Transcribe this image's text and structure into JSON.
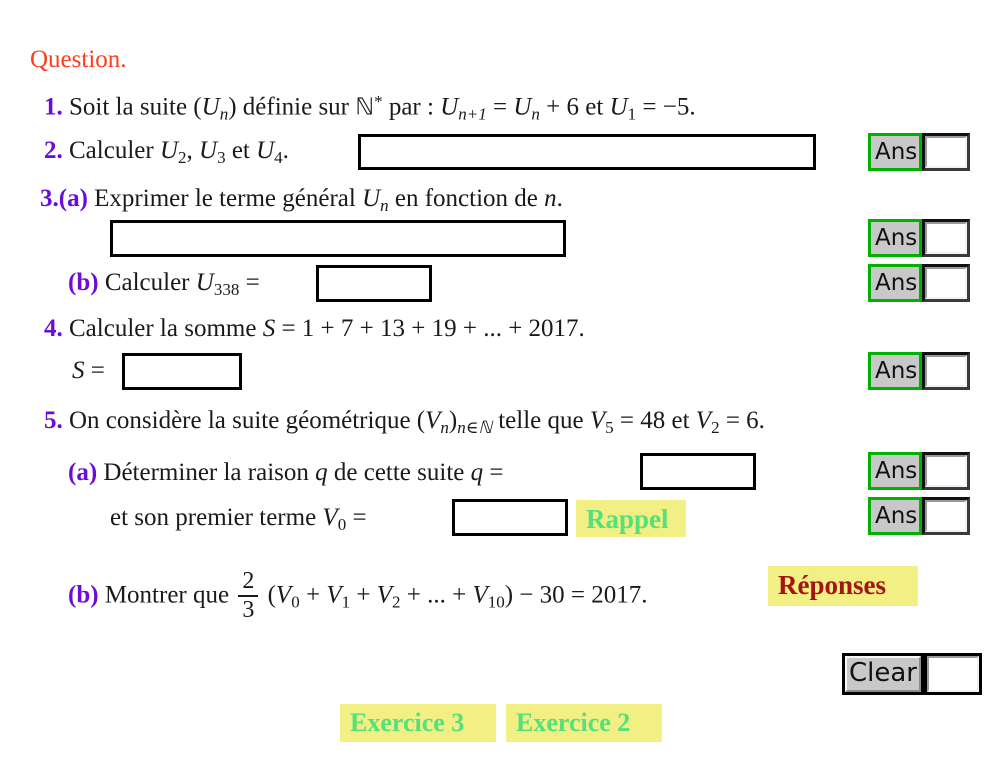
{
  "page": {
    "title_label": "Question.",
    "title_color": "#ff3b20",
    "number_color": "#6a0dd6"
  },
  "items": {
    "q1": {
      "number": "1.",
      "text_a": "Soit la suite (",
      "var_u": "U",
      "sub_n": "n",
      "text_b": ") définie sur ",
      "set": "ℕ",
      "star": "*",
      "text_c": " par : ",
      "rec_u1": "U",
      "rec_sub1": "n+1",
      "eq1": " = ",
      "rec_u2": "U",
      "rec_sub2": "n",
      "plus6": " + 6 et ",
      "rec_u3": "U",
      "rec_sub3": "1",
      "eq2": " = −5."
    },
    "q2": {
      "number": "2.",
      "text": "Calculer ",
      "u2": "U",
      "u2sub": "2",
      "comma": ", ",
      "u3": "U",
      "u3sub": "3",
      "and": " et ",
      "u4": "U",
      "u4sub": "4",
      "period": "."
    },
    "q3a": {
      "number": "3.(a)",
      "text_a": "Exprimer le terme général ",
      "var_u": "U",
      "sub_n": "n",
      "text_b": " en fonction de ",
      "var_n": "n",
      "period": "."
    },
    "q3b": {
      "number": "(b)",
      "text": "Calculer ",
      "var_u": "U",
      "sub": "338",
      "equals": " ="
    },
    "q4": {
      "number": "4.",
      "text_a": "Calculer la somme ",
      "var_s": "S",
      "text_b": " = 1 + 7 + 13 + 19 + ... + 2017.",
      "s_label": "S",
      "s_equals": " ="
    },
    "q5": {
      "number": "5.",
      "text_a": "On considère la suite géométrique (",
      "var_v": "V",
      "sub_n": "n",
      "text_b": ")",
      "sub_nin": "n∈ℕ",
      "text_c": " telle que ",
      "v5": "V",
      "v5sub": "5",
      "v5val": " = 48 et ",
      "v2": "V",
      "v2sub": "2",
      "v2val": " = 6."
    },
    "q5a": {
      "number": "(a)",
      "text_a": "Déterminer la raison ",
      "var_q": "q",
      "text_b": " de cette suite ",
      "var_q2": "q",
      "equals": " =",
      "line2_text": "et son premier terme ",
      "var_v0": "V",
      "v0sub": "0",
      "v0equals": " ="
    },
    "q5b": {
      "number": "(b)",
      "text_a": "Montrer que ",
      "frac_num": "2",
      "frac_den": "3",
      "text_b": " (",
      "v0": "V",
      "v0sub": "0",
      "p1": " + ",
      "v1": "V",
      "v1sub": "1",
      "p2": " + ",
      "v2": "V",
      "v2sub": "2",
      "p3": " + ... + ",
      "v10": "V",
      "v10sub": "10",
      "tail": ") − 30 = 2017."
    }
  },
  "answer_buttons": {
    "label": "Ans",
    "value": "",
    "border_color": "#00b200",
    "background": "#c8c8c8"
  },
  "clear_button": {
    "label": "Clear",
    "value": ""
  },
  "links": {
    "rappel": "Rappel",
    "reponses": "Réponses",
    "exercice3": "Exercice 3",
    "exercice2": "Exercice 2",
    "highlight_color": "#f2f084",
    "green_color": "#55e07a",
    "red_color": "#a51414"
  },
  "input_fields": {
    "q2_answer": "",
    "q3a_answer": "",
    "q3b_answer": "",
    "q4_answer": "",
    "q5a_q_answer": "",
    "q5a_v0_answer": ""
  }
}
